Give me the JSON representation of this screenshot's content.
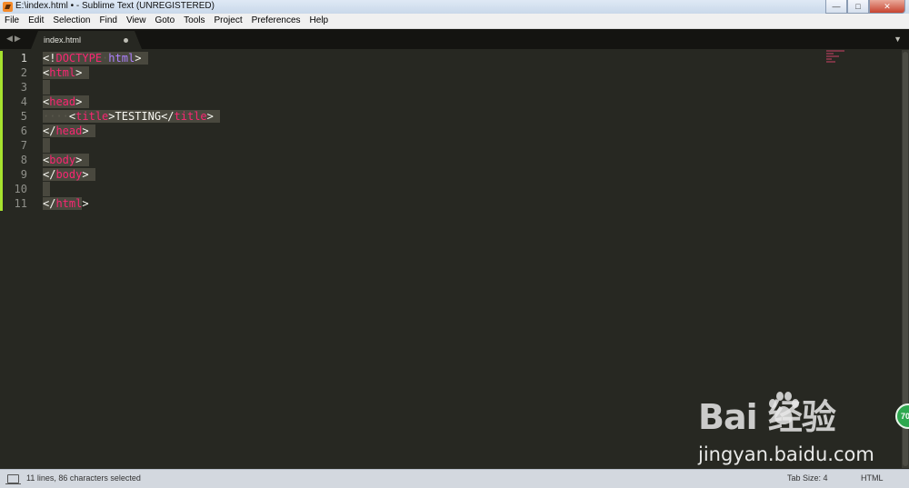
{
  "window": {
    "title": "E:\\index.html • - Sublime Text (UNREGISTERED)",
    "controls": [
      "minimize",
      "maximize",
      "close"
    ]
  },
  "menu": [
    "File",
    "Edit",
    "Selection",
    "Find",
    "View",
    "Goto",
    "Tools",
    "Project",
    "Preferences",
    "Help"
  ],
  "tabs": [
    {
      "label": "index.html",
      "dirty": true
    }
  ],
  "editor": {
    "line_numbers": [
      "1",
      "2",
      "3",
      "4",
      "5",
      "6",
      "7",
      "8",
      "9",
      "10",
      "11"
    ],
    "current_line": "1",
    "code": {
      "l1": {
        "lt": "<",
        "bang": "!",
        "doctype": "DOCTYPE",
        "sp": "·",
        "html": "html",
        "gt": ">"
      },
      "l2": {
        "lt": "<",
        "tag": "html",
        "gt": ">"
      },
      "l4": {
        "lt": "<",
        "tag": "head",
        "gt": ">"
      },
      "l5": {
        "indent": "····",
        "lt": "<",
        "tag": "title",
        "gt": ">",
        "text": "TESTING",
        "lt2": "</",
        "tag2": "title",
        "gt2": ">"
      },
      "l6": {
        "lt": "</",
        "tag": "head",
        "gt": ">"
      },
      "l8": {
        "lt": "<",
        "tag": "body",
        "gt": ">"
      },
      "l9": {
        "lt": "</",
        "tag": "body",
        "gt": ">"
      },
      "l11": {
        "lt": "</",
        "tag": "html",
        "gt": ">"
      }
    }
  },
  "status": {
    "text": "11 lines, 86 characters selected",
    "tab_size": "Tab Size: 4",
    "syntax": "HTML"
  },
  "watermark": {
    "logo": "Bai   经验",
    "url": "jingyan.baidu.com"
  },
  "badge": {
    "text": "70"
  },
  "colors": {
    "background": "#272822",
    "tag": "#f92672",
    "keyword": "#ae81ff",
    "text": "#f8f8f2",
    "selection": "#49483e",
    "gutter_marker": "#a6e22e"
  }
}
